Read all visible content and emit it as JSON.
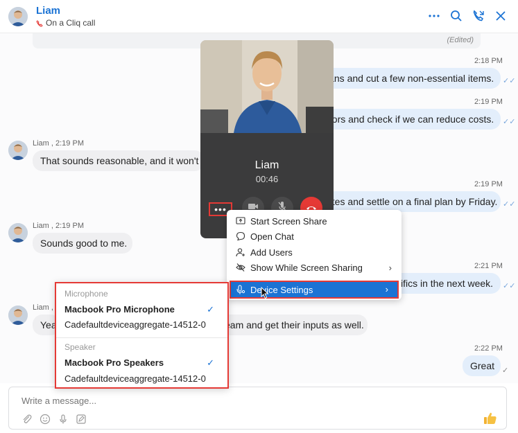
{
  "header": {
    "name": "Liam",
    "status": "On a Cliq call"
  },
  "messages": {
    "edited": "(Edited)",
    "m1": {
      "time": "2:18 PM",
      "text": "lans and cut a few non-essential items."
    },
    "m2": {
      "time": "2:19 PM",
      "text": "dors and check if we can reduce costs."
    },
    "m3": {
      "sender": "Liam , 2:19 PM",
      "text": "That sounds reasonable, and it won't af"
    },
    "m4": {
      "time": "2:19 PM",
      "text": "ates and settle on a final plan by Friday."
    },
    "m5": {
      "sender": "Liam , 2:19 PM",
      "text": "Sounds good to me."
    },
    "m6": {
      "time": "2:21 PM",
      "text": "cifics in the next week."
    },
    "m7": {
      "sender": "Liam , 2:19 PM",
      "text_left": "Yea",
      "text_right": "eam and get their inputs as well."
    },
    "m8": {
      "time": "2:22 PM",
      "text": "Great"
    }
  },
  "composer": {
    "placeholder": "Write a message..."
  },
  "call": {
    "name": "Liam",
    "timer": "00:46",
    "more": "•••"
  },
  "menu": {
    "items": [
      {
        "label": "Start Screen Share"
      },
      {
        "label": "Open Chat"
      },
      {
        "label": "Add Users"
      },
      {
        "label": "Show While Screen Sharing"
      },
      {
        "label": "Device Settings"
      }
    ]
  },
  "devices": {
    "microphone_heading": "Microphone",
    "microphones": [
      {
        "label": "Macbook Pro Microphone",
        "selected": true
      },
      {
        "label": "Cadefaultdeviceaggregate-14512-0",
        "selected": false
      }
    ],
    "speaker_heading": "Speaker",
    "speakers": [
      {
        "label": "Macbook Pro Speakers",
        "selected": true
      },
      {
        "label": "Cadefaultdeviceaggregate-14512-0",
        "selected": false
      }
    ],
    "check": "✓"
  },
  "colors": {
    "accent": "#1b73d4",
    "highlight_border": "#e53935",
    "outgoing_bubble": "#e3eefb",
    "incoming_bubble": "#efeff1",
    "end_call": "#e53935"
  }
}
